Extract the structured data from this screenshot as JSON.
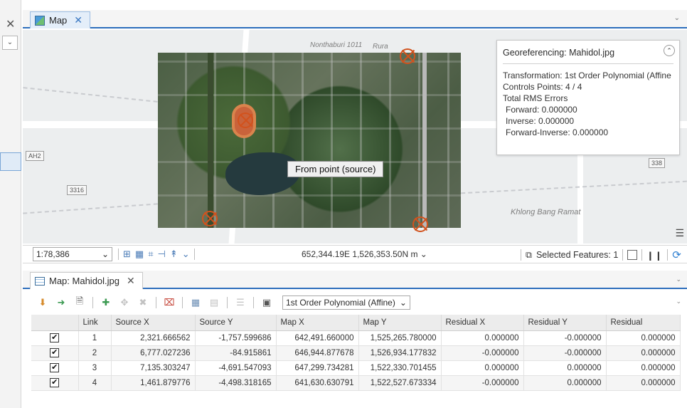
{
  "left_strip": {
    "close_glyph": "✕",
    "dropdown_glyph": "⌄"
  },
  "map_tab": {
    "label": "Map",
    "close_glyph": "✕"
  },
  "map": {
    "labels": {
      "road_top": "Nonthaburi 1011",
      "road_top_suffix": "Rura",
      "shield_ah2": "AH2",
      "shield_3316": "3316",
      "shield_338": "338",
      "khlong": "Khlong Bang Ramat"
    },
    "from_point_label": "From point (source)",
    "georef": {
      "title": "Georeferencing: Mahidol.jpg",
      "transformation": "Transformation: 1st Order Polynomial (Affine",
      "control_points": "Controls Points: 4 / 4",
      "total_rms": "Total RMS Errors",
      "forward": "Forward: 0.000000",
      "inverse": "Inverse: 0.000000",
      "forward_inverse": "Forward-Inverse: 0.000000"
    }
  },
  "status_bar": {
    "scale": "1:78,386",
    "coordinates": "652,344.19E 1,526,353.50N m",
    "selected_features": "Selected Features: 1"
  },
  "table_tab": {
    "label": "Map: Mahidol.jpg",
    "close_glyph": "✕"
  },
  "toolbar": {
    "transformation_value": "1st Order Polynomial (Affine)"
  },
  "table": {
    "columns": [
      "",
      "Link",
      "Source X",
      "Source Y",
      "Map X",
      "Map Y",
      "Residual X",
      "Residual Y",
      "Residual"
    ],
    "rows": [
      {
        "checked": "✔",
        "link": "1",
        "source_x": "2,321.666562",
        "source_y": "-1,757.599686",
        "map_x": "642,491.660000",
        "map_y": "1,525,265.780000",
        "res_x": "0.000000",
        "res_y": "-0.000000",
        "res": "0.000000"
      },
      {
        "checked": "✔",
        "link": "2",
        "source_x": "6,777.027236",
        "source_y": "-84.915861",
        "map_x": "646,944.877678",
        "map_y": "1,526,934.177832",
        "res_x": "-0.000000",
        "res_y": "-0.000000",
        "res": "0.000000"
      },
      {
        "checked": "✔",
        "link": "3",
        "source_x": "7,135.303247",
        "source_y": "-4,691.547093",
        "map_x": "647,299.734281",
        "map_y": "1,522,330.701455",
        "res_x": "0.000000",
        "res_y": "0.000000",
        "res": "0.000000"
      },
      {
        "checked": "✔",
        "link": "4",
        "source_x": "1,461.879776",
        "source_y": "-4,498.318165",
        "map_x": "641,630.630791",
        "map_y": "1,522,527.673334",
        "res_x": "-0.000000",
        "res_y": "0.000000",
        "res": "0.000000"
      }
    ]
  }
}
